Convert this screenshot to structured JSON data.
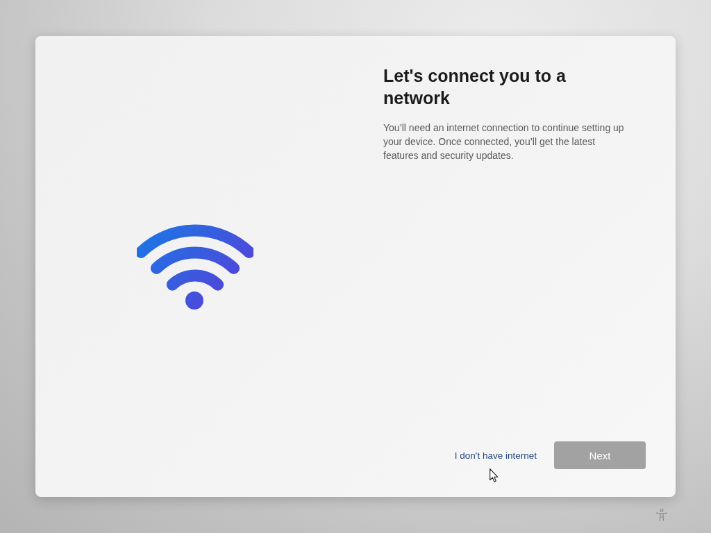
{
  "card": {
    "title": "Let's connect you to a network",
    "description": "You’ll need an internet connection to continue setting up your device. Once connected, you’ll get the latest features and security updates."
  },
  "actions": {
    "link": "I don't have internet",
    "next_button": {
      "label": "Next",
      "disabled": true
    }
  }
}
